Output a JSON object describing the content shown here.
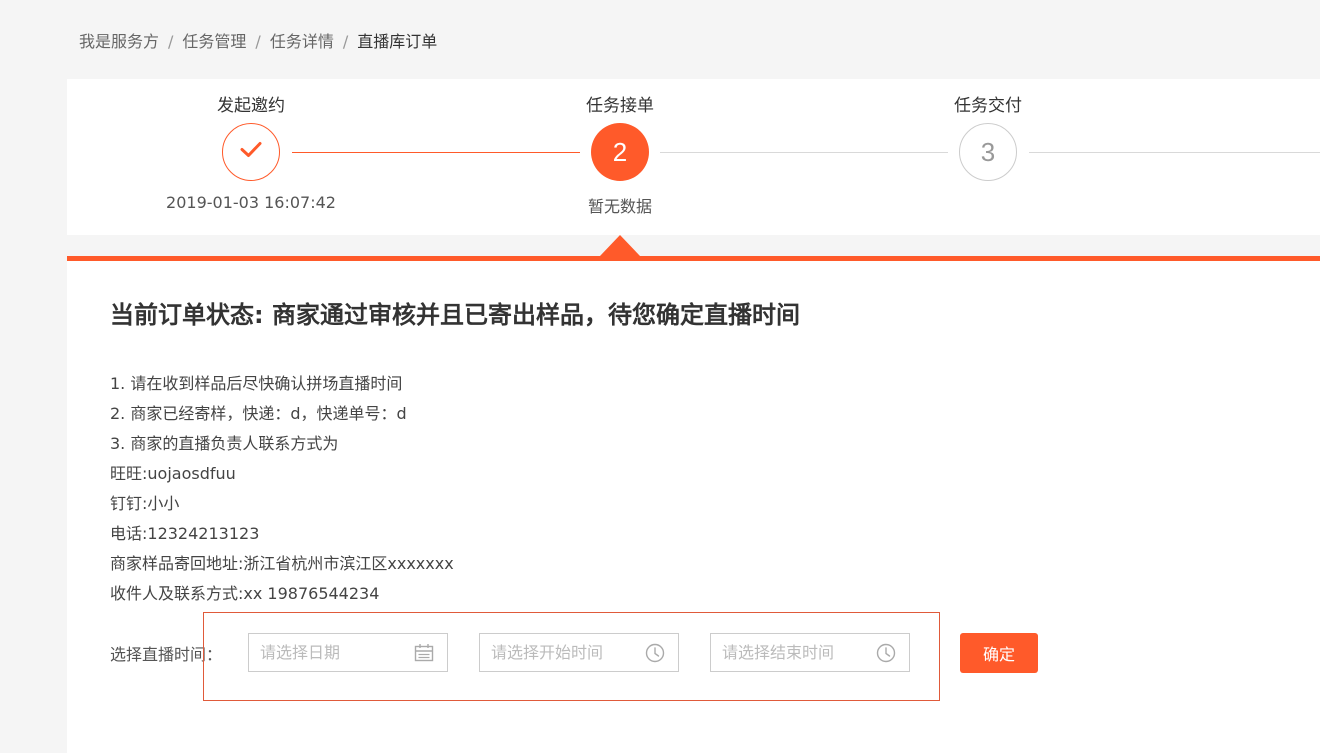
{
  "breadcrumb": {
    "items": [
      "我是服务方",
      "任务管理",
      "任务详情",
      "直播库订单"
    ],
    "separator": "/"
  },
  "steps": [
    {
      "title": "发起邀约",
      "marker": "",
      "sub": "2019-01-03 16:07:42",
      "state": "done"
    },
    {
      "title": "任务接单",
      "marker": "2",
      "sub": "暂无数据",
      "state": "active"
    },
    {
      "title": "任务交付",
      "marker": "3",
      "sub": "",
      "state": "todo"
    }
  ],
  "order": {
    "status_title": "当前订单状态: 商家通过审核并且已寄出样品，待您确定直播时间",
    "info_lines": [
      "1. 请在收到样品后尽快确认拼场直播时间",
      "2. 商家已经寄样，快递：d，快递单号：d",
      "3. 商家的直播负责人联系方式为",
      "旺旺:uojaosdfuu",
      "钉钉:小小",
      "电话:12324213123",
      "商家样品寄回地址:浙江省杭州市滨江区xxxxxxx",
      "收件人及联系方式:xx 19876544234"
    ]
  },
  "schedule": {
    "label": "选择直播时间：",
    "date_placeholder": "请选择日期",
    "start_placeholder": "请选择开始时间",
    "end_placeholder": "请选择结束时间",
    "date_value": "",
    "start_value": "",
    "end_value": "",
    "confirm_label": "确定"
  },
  "colors": {
    "accent": "#ff5a2a",
    "highlight_border": "#e05a3a"
  },
  "icons": {
    "step_done": "check-icon",
    "date_picker": "calendar-icon",
    "time_picker": "clock-icon"
  }
}
